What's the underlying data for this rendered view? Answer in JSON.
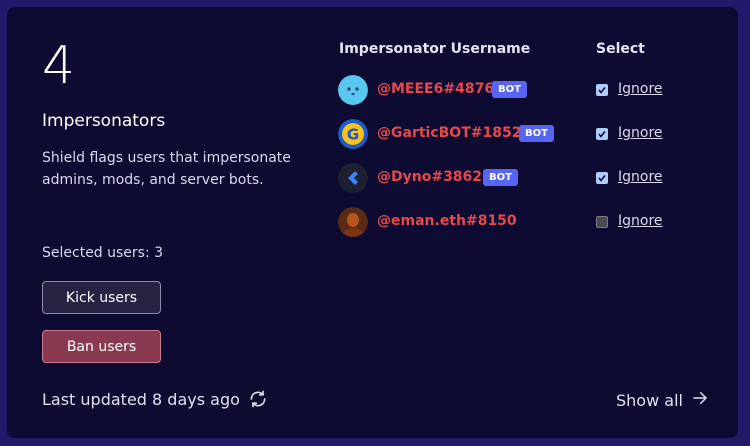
{
  "summary": {
    "count": "4",
    "title": "Impersonators",
    "description": "Shield flags users that impersonate admins, mods, and server bots.",
    "selected_text": "Selected users: 3"
  },
  "actions": {
    "kick_label": "Kick users",
    "ban_label": "Ban users"
  },
  "footer": {
    "last_updated": "Last updated 8 days ago",
    "show_all": "Show all"
  },
  "table": {
    "headers": {
      "username": "Impersonator Username",
      "select": "Select"
    },
    "rows": [
      {
        "username": "@MEEE6#4876",
        "bot_badge": "BOT",
        "checked": true,
        "action": "Ignore",
        "avatar_icon": "meee6-avatar"
      },
      {
        "username": "@GarticBOT#1852",
        "bot_badge": "BOT",
        "checked": true,
        "action": "Ignore",
        "avatar_icon": "gartic-avatar"
      },
      {
        "username": "@Dyno#3862",
        "bot_badge": "BOT",
        "checked": true,
        "action": "Ignore",
        "avatar_icon": "dyno-avatar"
      },
      {
        "username": "@eman.eth#8150",
        "bot_badge": "",
        "checked": false,
        "action": "Ignore",
        "avatar_icon": "user-avatar"
      }
    ]
  },
  "colors": {
    "background": "#211A6A",
    "card": "#0E0B32",
    "username": "#E5484D",
    "bot_badge": "#5865F2",
    "ban_button": "#8A3A50"
  }
}
